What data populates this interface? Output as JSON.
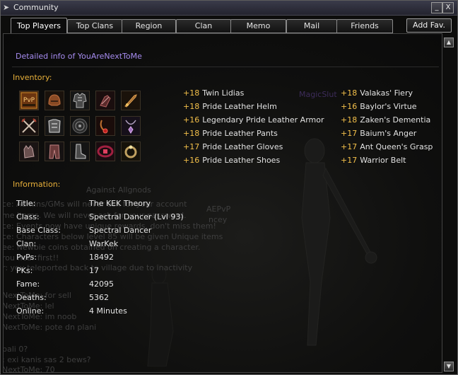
{
  "window": {
    "title": "Community"
  },
  "title_buttons": {
    "minimize": "_",
    "close": "X"
  },
  "tabs": [
    {
      "label": "Top Players",
      "active": true
    },
    {
      "label": "Top Clans"
    },
    {
      "label": "Region"
    },
    {
      "label": "Clan"
    },
    {
      "label": "Memo"
    },
    {
      "label": "Mail"
    },
    {
      "label": "Friends"
    }
  ],
  "add_fav": "Add Fav.",
  "detail_header": "Detailed info of YouAreNextToMe",
  "inventory": {
    "heading": "Inventory:",
    "icons": [
      "pvp-bracelet-icon",
      "leather-helm-icon",
      "leather-armor-icon",
      "gloves-icon",
      "dagger-icon",
      "twin-swords-icon",
      "leather-shirt-icon",
      "shield-icon",
      "earring-icon",
      "necklace-icon",
      "leather-gloves-icon",
      "leather-pants-icon",
      "leather-boots-icon",
      "belt-icon",
      "ring-icon"
    ],
    "left_items": [
      {
        "enchant": "+18",
        "name": "Twin Lidias"
      },
      {
        "enchant": "+18",
        "name": "Pride Leather Helm"
      },
      {
        "enchant": "+16",
        "name": "Legendary Pride Leather Armor"
      },
      {
        "enchant": "+18",
        "name": "Pride Leather Pants"
      },
      {
        "enchant": "+17",
        "name": "Pride Leather Gloves"
      },
      {
        "enchant": "+16",
        "name": "Pride Leather Shoes"
      }
    ],
    "right_items": [
      {
        "enchant": "+18",
        "name": "Valakas' Fiery"
      },
      {
        "enchant": "+16",
        "name": "Baylor's Virtue"
      },
      {
        "enchant": "+18",
        "name": "Zaken's Dementia"
      },
      {
        "enchant": "+17",
        "name": "Baium's Anger"
      },
      {
        "enchant": "+17",
        "name": "Ant Queen's Grasp"
      },
      {
        "enchant": "+17",
        "name": "Warrior Belt"
      }
    ]
  },
  "information": {
    "heading": "Information:",
    "rows": [
      {
        "label": "Title:",
        "value": "The KEK Theory"
      },
      {
        "label": "Class:",
        "value": "Spectral Dancer (Lvl 93)"
      },
      {
        "label": "Base Class:",
        "value": "Spectral Dancer"
      },
      {
        "label": "Clan:",
        "value": "WarKek"
      },
      {
        "label": "PvPs:",
        "value": "18492"
      },
      {
        "label": "PKs:",
        "value": "17"
      },
      {
        "label": "Fame:",
        "value": "42095"
      },
      {
        "label": "Deaths:",
        "value": "5362"
      },
      {
        "label": "Online:",
        "value": "4 Minutes"
      }
    ]
  },
  "background_text": {
    "magic_slut": "MagicSlut",
    "against_all": "Against Allgnods",
    "aepvp": "AEPvP",
    "ncey": "ncey",
    "chat": [
      "ce: Admins/GMs will never ask for your account",
      "me items. We will never ask for your password.",
      "ce: Events now have unique rewards, don't miss them!",
      "ce: Characters below level 85 will be given Unique items",
      "ee: Newbie coins obtained on creating a character.",
      "rou hear first!!",
      "r: you teleported back to village due to inactivity",
      "NextToMe: for sell",
      "NextToMe: lel",
      "NextToMe: im noob",
      "NextToMe: pote dn plani",
      "pali 0?",
      ": exi kanis sas 2 bews?",
      "NextToMe: 70"
    ]
  }
}
